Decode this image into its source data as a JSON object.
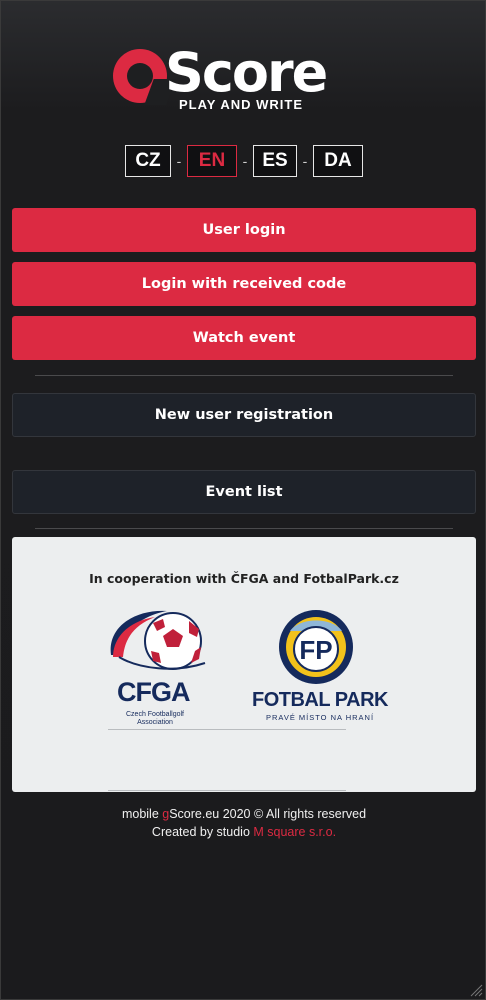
{
  "logo": {
    "letter": "g",
    "word": "Score",
    "tagline": "PLAY AND WRITE"
  },
  "languages": [
    {
      "code": "CZ",
      "selected": false
    },
    {
      "code": "EN",
      "selected": true
    },
    {
      "code": "ES",
      "selected": false
    },
    {
      "code": "DA",
      "selected": false
    }
  ],
  "separator": "-",
  "buttons": {
    "user_login": "User login",
    "login_code": "Login with received code",
    "watch_event": "Watch event",
    "new_registration": "New user registration",
    "event_list": "Event list"
  },
  "cooperation": {
    "title": "In cooperation with ČFGA and FotbalPark.cz",
    "cfga_name": "CFGA",
    "cfga_sub": "Czech Footballgolf Association",
    "fp_monogram": "FP",
    "fp_name": "FOTBAL PARK",
    "fp_tagline": "PRAVÉ MÍSTO NA HRANÍ"
  },
  "footer": {
    "prefix": "mobile ",
    "brand_g": "g",
    "brand_rest": "Score.eu 2020 © All rights reserved",
    "created_by": "Created by studio ",
    "studio": "M square s.r.o."
  },
  "colors": {
    "accent": "#dc2a42",
    "background": "#1b1b1d",
    "dark_button": "#1e2229",
    "panel": "#eceeef",
    "navy": "#152a5c"
  }
}
